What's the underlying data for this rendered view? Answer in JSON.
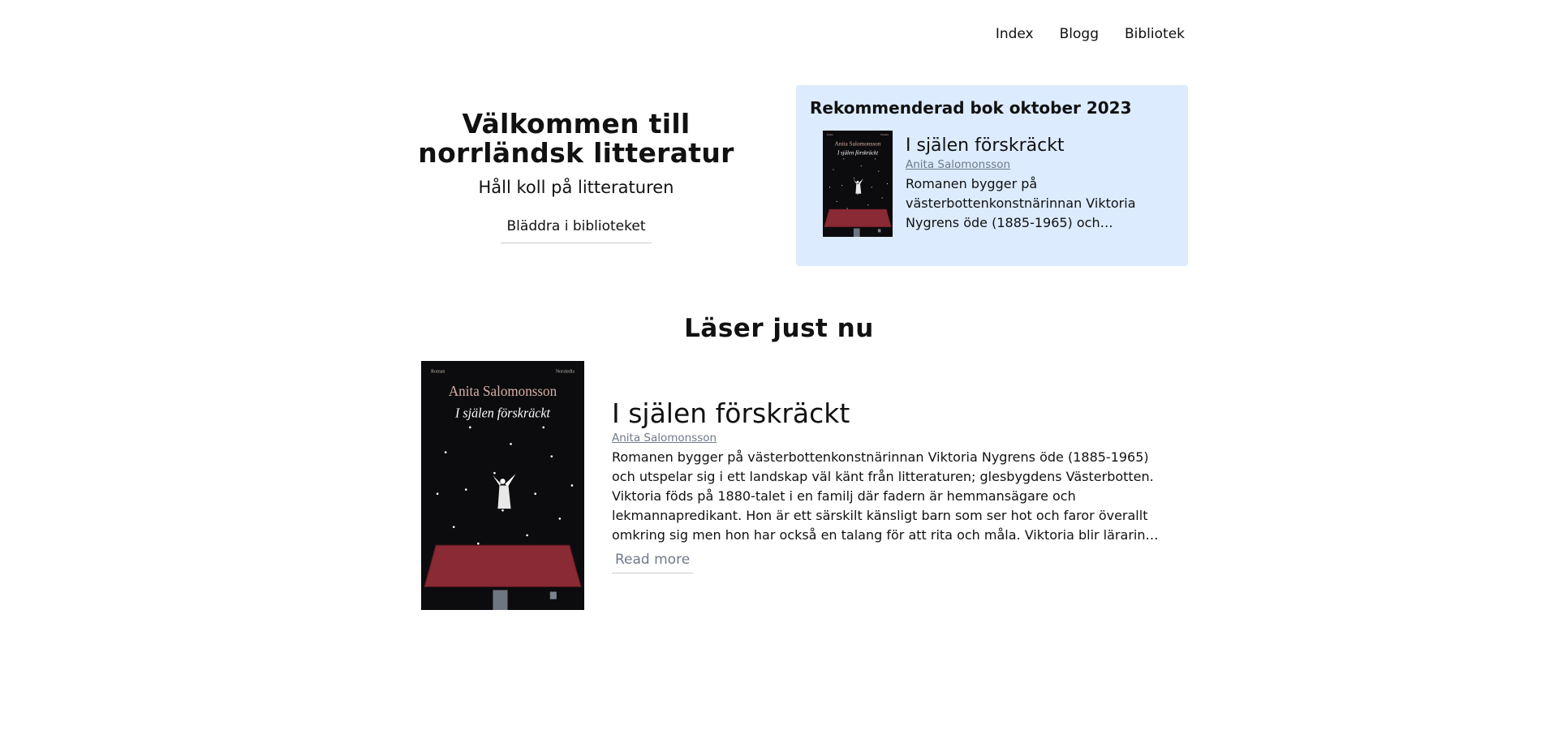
{
  "nav": {
    "items": [
      {
        "label": "Index"
      },
      {
        "label": "Blogg"
      },
      {
        "label": "Bibliotek"
      }
    ]
  },
  "hero": {
    "title": "Välkommen till norrländsk litteratur",
    "subtitle": "Håll koll på litteraturen",
    "browse_label": "Bläddra i biblioteket"
  },
  "recommended": {
    "heading": "Rekommenderad bok oktober 2023",
    "book": {
      "title": "I själen förskräckt",
      "author": "Anita Salomonsson",
      "description": "Romanen bygger på västerbottenkonstnärinnan Viktoria Nygrens öde (1885-1965) och utspelar sig i ett landskap väl känt från litteraturen; glesbygdens Västerbotten."
    }
  },
  "reading_now": {
    "heading": "Läser just nu",
    "book": {
      "title": "I själen förskräckt",
      "author": "Anita Salomonsson",
      "description": "Romanen bygger på västerbottenkonstnärinnan Viktoria Nygrens öde (1885-1965) och utspelar sig i ett landskap väl känt från litteraturen; glesbygdens Västerbotten. Viktoria föds på 1880-talet i en familj där fadern är hemmansägare och lekmannapredikant. Hon är ett särskilt känsligt barn som ser hot och faror överallt omkring sig men hon har också en talang för att rita och måla. Viktoria blir lärarinna och får tjänst i en byskola några mil från hemmet.",
      "read_more_label": "Read more"
    }
  },
  "cover": {
    "top_left": "Roman",
    "top_right": "Norstedts",
    "author": "Anita Salomonsson",
    "title": "I själen förskräckt",
    "colors": {
      "background": "#0c0c0e",
      "author": "#d9b0a8",
      "title": "#ffffff",
      "roof": "#8a2a34"
    }
  }
}
